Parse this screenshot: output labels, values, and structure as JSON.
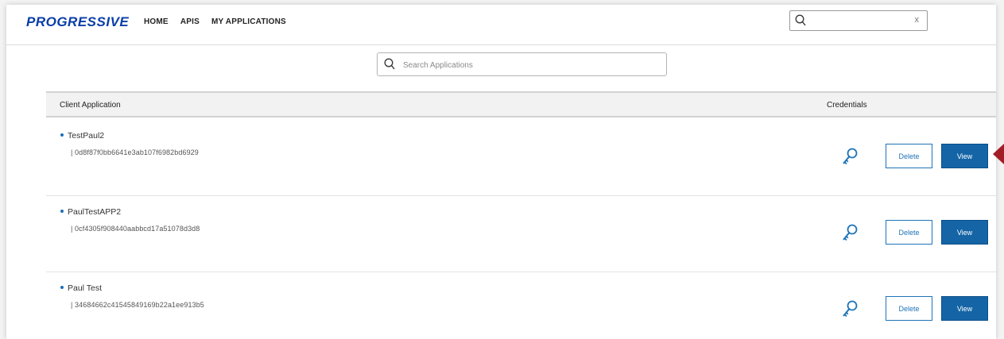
{
  "header": {
    "logo": "PROGRESSIVE",
    "nav": [
      "HOME",
      "APIS",
      "MY APPLICATIONS"
    ],
    "search": {
      "value": "",
      "placeholder": "",
      "clear_label": "x"
    }
  },
  "app_search": {
    "placeholder": "Search Applications",
    "value": ""
  },
  "table": {
    "headers": {
      "client": "Client Application",
      "credentials": "Credentials"
    },
    "rows": [
      {
        "name": "TestPaul2",
        "client_id": "| 0d8f87f0bb6641e3ab107f6982bd6929",
        "delete_label": "Delete",
        "view_label": "View"
      },
      {
        "name": "PaulTestAPP2",
        "client_id": "| 0cf4305f908440aabbcd17a51078d3d8",
        "delete_label": "Delete",
        "view_label": "View"
      },
      {
        "name": "Paul Test",
        "client_id": "| 34684662c41545849169b22a1ee913b5",
        "delete_label": "Delete",
        "view_label": "View"
      }
    ]
  },
  "icons": {
    "search": "search-icon",
    "key": "key-icon",
    "marker": "arrow-marker-icon"
  },
  "colors": {
    "brand": "#0a3ea8",
    "primary_button": "#1565a6",
    "marker": "#a31d27",
    "bullet": "#1d6fb8"
  }
}
